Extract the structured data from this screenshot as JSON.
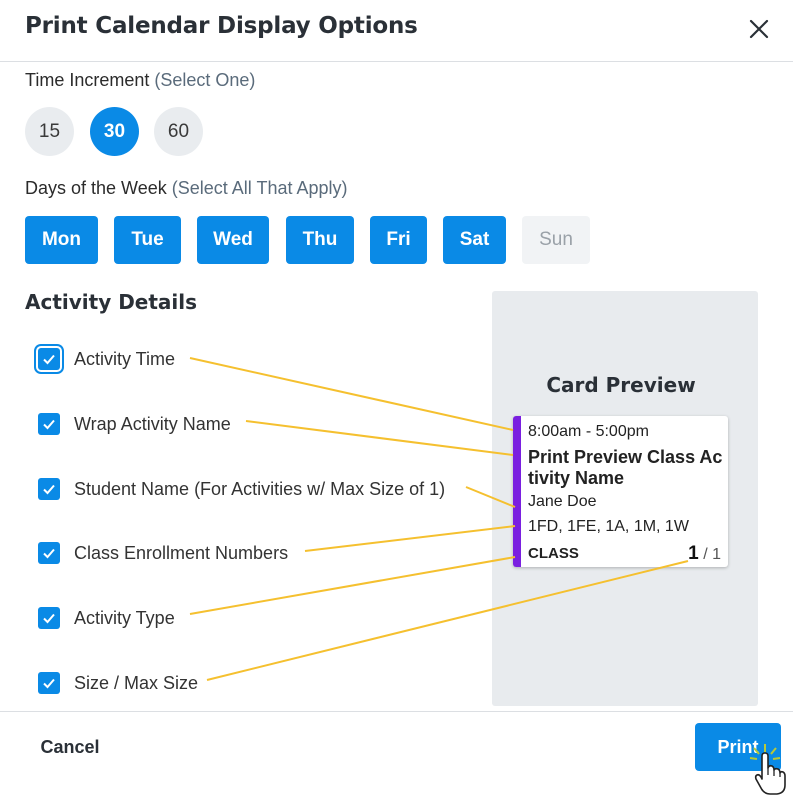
{
  "dialog": {
    "title": "Print Calendar Display Options",
    "close_icon": "close-icon"
  },
  "time_increment": {
    "label": "Time Increment",
    "hint": "(Select One)",
    "options": [
      "15",
      "30",
      "60"
    ],
    "selected": "30"
  },
  "days_of_week": {
    "label": "Days of the Week",
    "hint": "(Select All That Apply)",
    "days": [
      {
        "label": "Mon",
        "selected": true
      },
      {
        "label": "Tue",
        "selected": true
      },
      {
        "label": "Wed",
        "selected": true
      },
      {
        "label": "Thu",
        "selected": true
      },
      {
        "label": "Fri",
        "selected": true
      },
      {
        "label": "Sat",
        "selected": true
      },
      {
        "label": "Sun",
        "selected": false
      }
    ]
  },
  "activity_details": {
    "heading": "Activity Details",
    "options": [
      {
        "label": "Activity Time",
        "checked": true
      },
      {
        "label": "Wrap Activity Name",
        "checked": true
      },
      {
        "label": "Student Name (For Activities w/ Max Size of 1)",
        "checked": true
      },
      {
        "label": "Class Enrollment Numbers",
        "checked": true
      },
      {
        "label": "Activity Type",
        "checked": true
      },
      {
        "label": "Size / Max Size",
        "checked": true
      }
    ]
  },
  "preview": {
    "title": "Card Preview",
    "card": {
      "time": "8:00am - 5:00pm",
      "name": "Print Preview Class Activity Name",
      "student": "Jane Doe",
      "enrollment": "1FD, 1FE, 1A, 1M, 1W",
      "type": "CLASS",
      "size": "1",
      "max_size": "/ 1",
      "accent_color": "#7a1fe0"
    }
  },
  "footer": {
    "cancel_label": "Cancel",
    "print_label": "Print"
  },
  "colors": {
    "primary": "#0a8ae6",
    "connector": "#f5c02f"
  }
}
